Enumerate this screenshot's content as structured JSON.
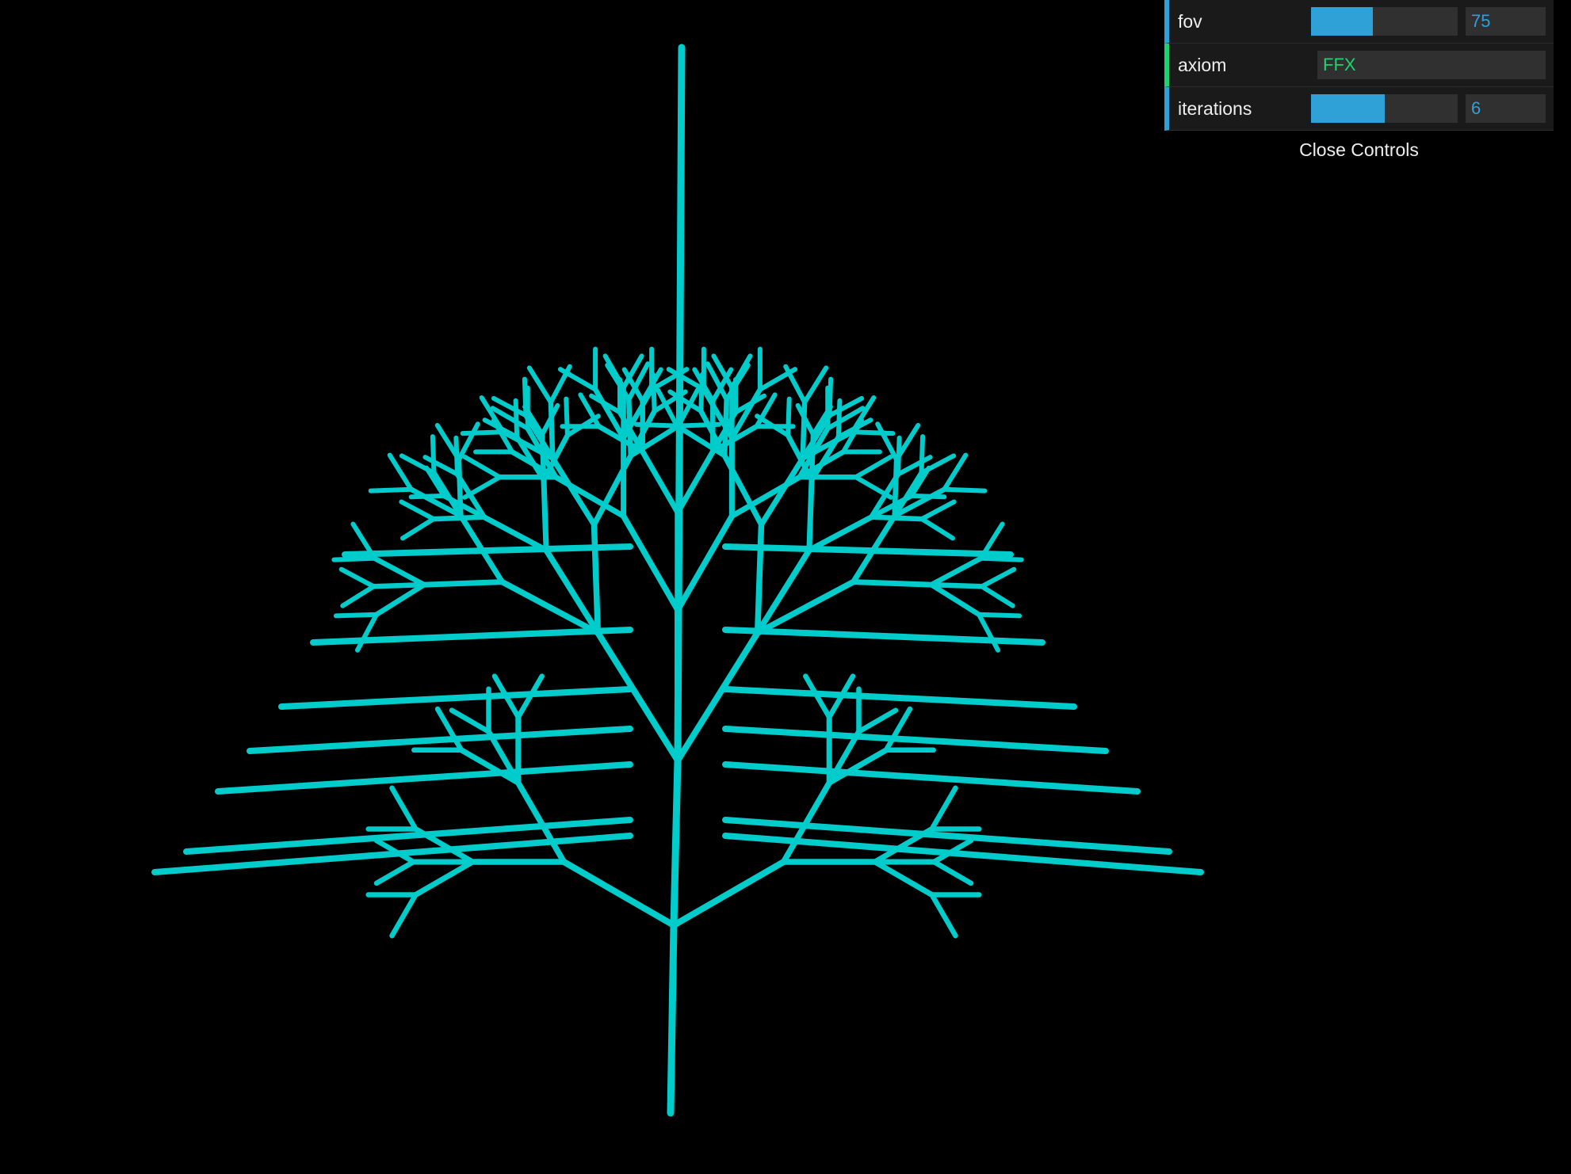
{
  "canvas": {
    "background": "#000000",
    "stroke_color": "#00cccc"
  },
  "controls": {
    "fov": {
      "label": "fov",
      "value": "75",
      "fill_fraction": 0.42
    },
    "axiom": {
      "label": "axiom",
      "value": "FFX"
    },
    "iterations": {
      "label": "iterations",
      "value": "6",
      "fill_fraction": 0.5
    },
    "close_label": "Close Controls"
  },
  "colors": {
    "number_accent": "#2fa1d6",
    "string_accent": "#1ed36f",
    "panel_bg": "#1a1a1a",
    "field_bg": "#303030"
  }
}
